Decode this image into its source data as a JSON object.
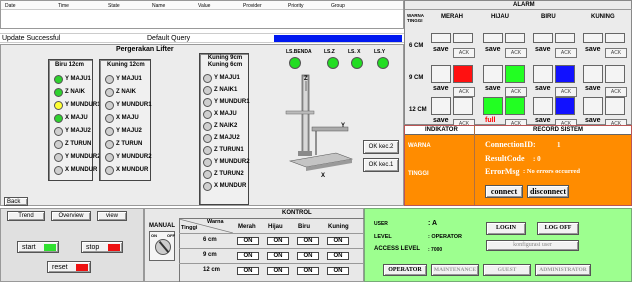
{
  "table": {
    "headers": [
      "Date",
      "Time",
      "State",
      "Name",
      "Value",
      "Provider",
      "Priority",
      "Group"
    ]
  },
  "status": {
    "update": "Update Successful",
    "query": "Default Query"
  },
  "lift": {
    "title": "Pergerakan Lifter",
    "col1": {
      "title": "Biru 12cm",
      "items": [
        "Y MAJU1",
        "Z NAIK",
        "Y MUNDUR1",
        "X MAJU",
        "Y MAJU2",
        "Z TURUN",
        "Y MUNDUR2",
        "X MUNDUR"
      ],
      "colors": [
        "#2fd12f",
        "#2fd12f",
        "#ffff33",
        "#2fd12f",
        "#cfcfcf",
        "#cfcfcf",
        "#cfcfcf",
        "#cfcfcf"
      ]
    },
    "col2": {
      "title": "Kuning 12cm",
      "items": [
        "Y MAJU1",
        "Z NAIK",
        "Y MUNDUR1",
        "X MAJU",
        "Y MAJU2",
        "Z TURUN",
        "Y MUNDUR2",
        "X MUNDUR"
      ]
    },
    "col3": {
      "title": "Kuning 9cm Kuning 6cm",
      "items": [
        "Y MAJU1",
        "Z NAIK1",
        "Y MUNDUR1",
        "X MAJU",
        "Z NAIK2",
        "Z MAJU2",
        "Z TURUN1",
        "Y MUNDUR2",
        "Z TURUN2",
        "X MUNDUR"
      ]
    },
    "sensors": [
      "LS.BENDA",
      "LS.Z",
      "LS. X",
      "LS.Y"
    ],
    "ok2": "OK kec.2",
    "ok1": "OK kec.1",
    "axis": {
      "z": "Z",
      "y": "Y",
      "x": "X"
    },
    "back": "Back"
  },
  "alarm": {
    "title": "ALARM",
    "corner": "WARNA TINGGI",
    "cols": [
      "MERAH",
      "HIJAU",
      "BIRU",
      "KUNING"
    ],
    "rows": [
      "6 CM",
      "9 CM",
      "12 CM"
    ],
    "save": "save",
    "ack": "ACK",
    "full": "full",
    "indikator": "INDIKATOR",
    "record": "RECORD SISTEM",
    "warna": "WARNA",
    "tinggi": "TINGGI",
    "conn_label": "ConnectionID:",
    "conn_val": "1",
    "res_label": "ResultCode",
    "res_val": ": 0",
    "err_label": "ErrorMsg",
    "err_val": ": No errors occurred",
    "connect": "connect",
    "disconnect": "disconnect"
  },
  "bottom": {
    "tabs": [
      "Trend",
      "Overview",
      "view"
    ],
    "start": "start",
    "stop": "stop",
    "reset": "reset",
    "manual": "MANUAL",
    "on": "ON",
    "off": "OFF",
    "kontrol": "KONTROL",
    "warna": "Warna",
    "tinggi": "Tinggi",
    "colors": [
      "Merah",
      "Hijau",
      "Biru",
      "Kuning"
    ],
    "heights": [
      "6 cm",
      "9 cm",
      "12 cm"
    ],
    "onlabel": "ON"
  },
  "user": {
    "user_label": "USER",
    "user_val": ": A",
    "level_label": "LEVEL",
    "level_val": ": OPERATOR",
    "access_label": "ACCESS LEVEL",
    "access_val": ": 7000",
    "login": "LOGIN",
    "logoff": "LOG OFF",
    "konfig": "konfigurasi user",
    "roles": [
      "OPERATOR",
      "MAINTENANCE",
      "GUEST",
      "ADMINISTRATOR"
    ]
  }
}
